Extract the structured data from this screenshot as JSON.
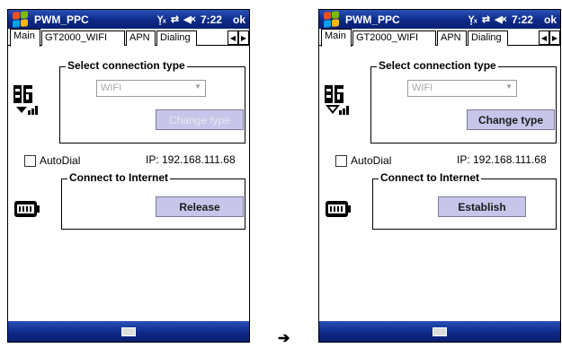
{
  "screens": [
    {
      "title": "PWM_PPC",
      "status": {
        "clock": "7:22",
        "ok": "ok"
      },
      "tabs": [
        "Main",
        "GT2000_WIFI",
        "APN",
        "Dialing"
      ],
      "connection_group": {
        "label": "Select connection type",
        "type_value": "WIFI",
        "change_button": "Change type",
        "change_enabled": false
      },
      "autodial": {
        "label": "AutoDial",
        "checked": false
      },
      "ip": "IP: 192.168.111.68",
      "internet_group": {
        "label": "Connect to Internet",
        "button": "Release"
      }
    },
    {
      "title": "PWM_PPC",
      "status": {
        "clock": "7:22",
        "ok": "ok"
      },
      "tabs": [
        "Main",
        "GT2000_WIFI",
        "APN",
        "Dialing"
      ],
      "connection_group": {
        "label": "Select connection type",
        "type_value": "WIFI",
        "change_button": "Change type",
        "change_enabled": true
      },
      "autodial": {
        "label": "AutoDial",
        "checked": false
      },
      "ip": "IP: 192.168.111.68",
      "internet_group": {
        "label": "Connect to Internet",
        "button": "Establish"
      }
    }
  ],
  "arrow": "➔",
  "colors": {
    "titlebar": "#0d2a88",
    "button": "#c7c5ea"
  }
}
